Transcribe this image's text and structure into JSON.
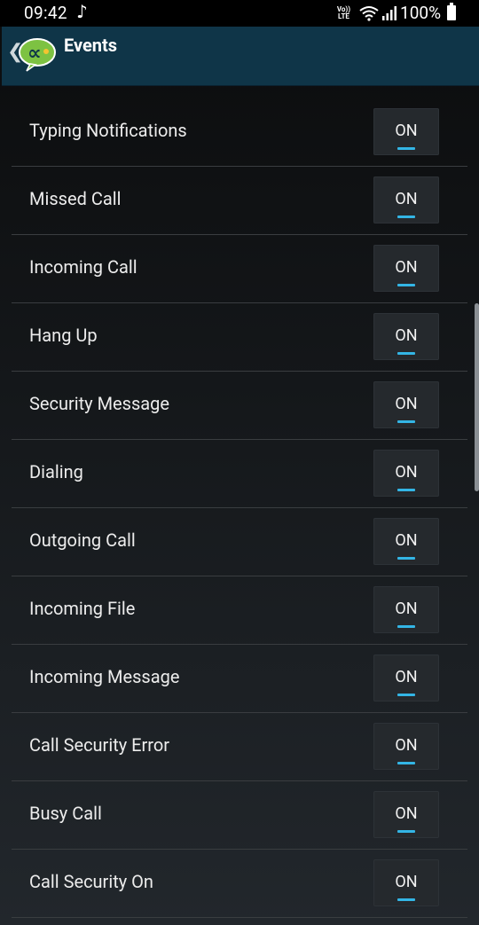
{
  "status_bar": {
    "time": "09:42",
    "music_glyph": "♪",
    "volte_top": "Vo))",
    "volte_bottom": "LTE",
    "battery": "100%"
  },
  "header": {
    "title": "Events",
    "back_glyph": "❮"
  },
  "settings": [
    {
      "label": "Typing Notifications",
      "state": "ON"
    },
    {
      "label": "Missed Call",
      "state": "ON"
    },
    {
      "label": "Incoming Call",
      "state": "ON"
    },
    {
      "label": "Hang Up",
      "state": "ON"
    },
    {
      "label": "Security Message",
      "state": "ON"
    },
    {
      "label": "Dialing",
      "state": "ON"
    },
    {
      "label": "Outgoing Call",
      "state": "ON"
    },
    {
      "label": "Incoming File",
      "state": "ON"
    },
    {
      "label": "Incoming Message",
      "state": "ON"
    },
    {
      "label": "Call Security Error",
      "state": "ON"
    },
    {
      "label": "Busy Call",
      "state": "ON"
    },
    {
      "label": "Call Security On",
      "state": "ON"
    }
  ],
  "colors": {
    "header_bg": "#0f3548",
    "toggle_accent": "#33b5e5",
    "logo_green": "#7dc242"
  }
}
